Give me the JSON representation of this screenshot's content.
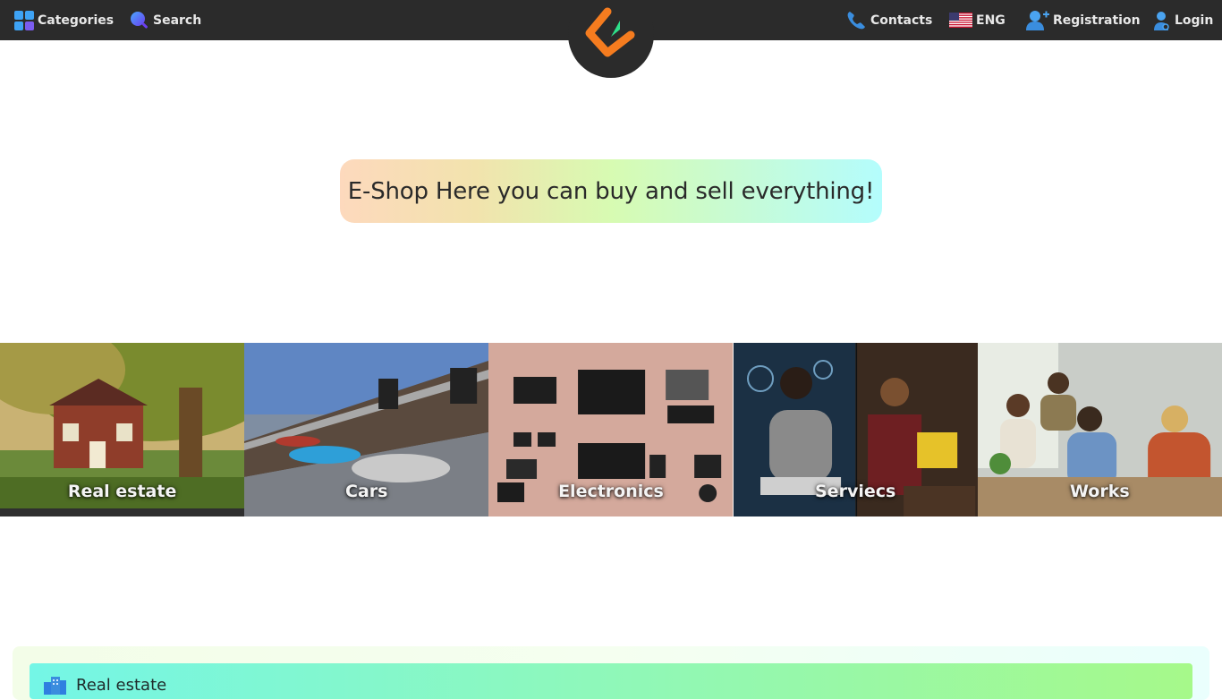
{
  "nav": {
    "categories_label": "Categories",
    "search_label": "Search",
    "contacts_label": "Contacts",
    "language_label": "ENG",
    "registration_label": "Registration",
    "login_label": "Login"
  },
  "hero": {
    "text": "E-Shop Here you can buy and sell everything!"
  },
  "categories": [
    {
      "label": "Real estate",
      "icon": "house-photo"
    },
    {
      "label": "Cars",
      "icon": "car-dealership-photo"
    },
    {
      "label": "Electronics",
      "icon": "gadgets-photo"
    },
    {
      "label": "Serviecs",
      "icon": "workers-photo"
    },
    {
      "label": "Works",
      "icon": "office-photo"
    }
  ],
  "section": {
    "title": "Real estate",
    "icon": "buildings-icon"
  },
  "colors": {
    "topbar": "#2b2b2b",
    "accent_blue": "#3a8dde",
    "logo_orange": "#f57c1f",
    "logo_green": "#2ee08a"
  }
}
